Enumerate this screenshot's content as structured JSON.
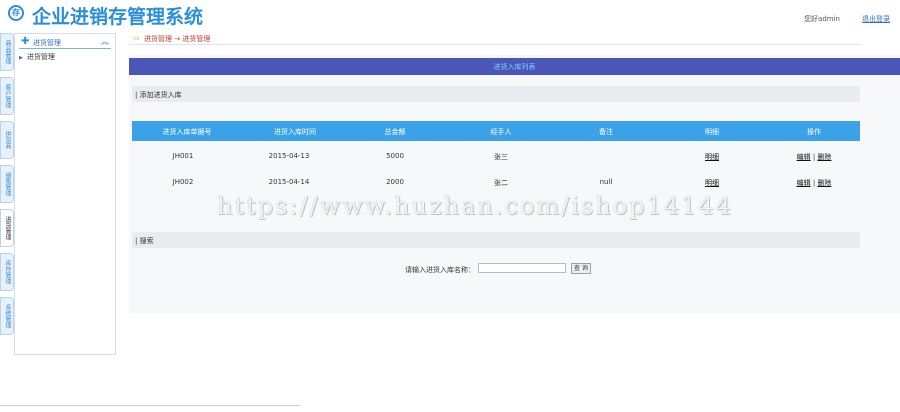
{
  "header": {
    "logo_glyph": "存",
    "title": "企业进销存管理系统",
    "welcome": "您好admin",
    "logout": "退出登录"
  },
  "left_tabs": [
    "商品管理",
    "客户管理",
    "供货商",
    "销售管理",
    "进货管理",
    "库存管理",
    "系统管理"
  ],
  "menu": {
    "title": "进货管理",
    "items": [
      "进货管理"
    ]
  },
  "breadcrumb": "进货管理 → 进货管理",
  "page_title": "进货入库列表",
  "add_section_label": "| 添加进货入库",
  "table": {
    "headers": [
      "进货入库单据号",
      "进货入库时间",
      "总金额",
      "经手人",
      "备注",
      "明细",
      "操作"
    ],
    "rows": [
      {
        "id": "JH001",
        "date": "2015-04-13",
        "amount": "5000",
        "handler": "张三",
        "note": "",
        "detail": "明细",
        "edit": "编辑",
        "sep": "|",
        "del": "删除"
      },
      {
        "id": "JH002",
        "date": "2015-04-14",
        "amount": "2000",
        "handler": "张二",
        "note": "null",
        "detail": "明细",
        "edit": "编辑",
        "sep": "|",
        "del": "删除"
      }
    ]
  },
  "search": {
    "section_label": "| 搜索",
    "label": "请输入进货入库名称：",
    "value": "",
    "button": "查 询"
  },
  "watermark": "https://www.huzhan.com/ishop14144",
  "footer": "",
  "colors": {
    "brand": "#2c8ed8",
    "bar": "#4a56b8",
    "table_head": "#3ca2e8"
  }
}
